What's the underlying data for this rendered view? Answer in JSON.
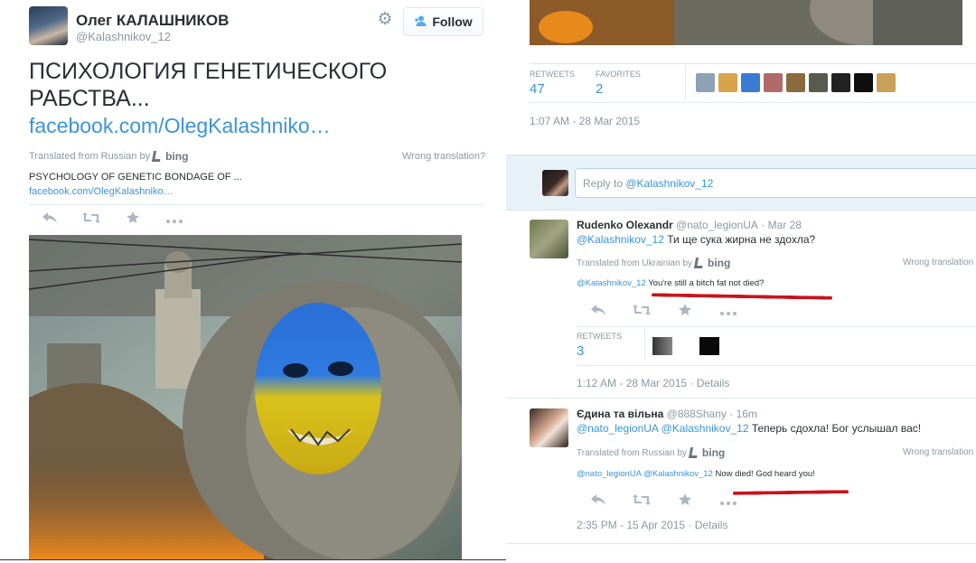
{
  "profile": {
    "full_name": "Олег КАЛАШНИКОВ",
    "username": "@Kalashnikov_12",
    "follow_label": "Follow"
  },
  "tweet": {
    "text": "ПСИХОЛОГИЯ ГЕНЕТИЧЕСКОГО РАБСТВА...",
    "link": "facebook.com/OlegKalashniko…",
    "translated_from": "Translated from Russian by",
    "bing_label": "bing",
    "wrong_translation": "Wrong translation?",
    "translation": "PSYCHOLOGY OF GENETIC BONDAGE OF ...",
    "translation_link": "facebook.com/OlegKalashniko…",
    "image_alt": "painting of a gorilla painted blue and yellow among ruins"
  },
  "stats": {
    "retweets_label": "RETWEETS",
    "retweets": "47",
    "favorites_label": "FAVORITES",
    "favorites": "2",
    "timestamp": "1:07 AM - 28 Mar 2015"
  },
  "reply_box": {
    "prefix": "Reply to",
    "mention": "@Kalashnikov_12"
  },
  "replies": [
    {
      "name": "Rudenko Olexandr",
      "handle": "@nato_legionUA",
      "time": "· Mar 28",
      "mention": "@Kalashnikov_12",
      "text": " Ти ще сука жирна не здохла?",
      "translated_from": "Translated from Ukrainian by",
      "bing_label": "bing",
      "wrong_translation": "Wrong translation",
      "translation_mention": "@Kalashnikov_12",
      "translation": " You're still a bitch fat not died?",
      "retweets_label": "RETWEETS",
      "retweets": "3",
      "timestamp": "1:12 AM - 28 Mar 2015",
      "details": " · Details"
    },
    {
      "name": "Єдина та вільна",
      "handle": "@888Shany",
      "time": "· 16m",
      "mention": "@nato_legionUA @Kalashnikov_12",
      "text": "  Теперь сдохла! Бог услышал вас!",
      "translated_from": "Translated from Russian by",
      "bing_label": "bing",
      "wrong_translation": "Wrong translation",
      "translation_mention": "@nato_legionUA @Kalashnikov_12",
      "translation": "  Now died! God heard you!",
      "timestamp": "2:35 PM - 15 Apr 2015",
      "details": " · Details"
    }
  ],
  "colors": {
    "link_blue": "#3b94d9",
    "muted_gray": "#8899a6",
    "annotation_red": "#c8141d"
  },
  "icons": [
    "gear-icon",
    "follow-person-icon",
    "reply-icon",
    "retweet-icon",
    "favorite-star-icon",
    "more-icon",
    "bing-icon"
  ]
}
